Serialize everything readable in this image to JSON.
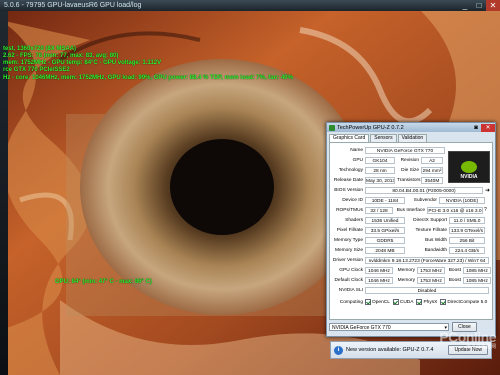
{
  "window": {
    "title": "5.0.6 - 79795  GPU-lavaeusR6  GPU load/log",
    "buttons": {
      "minimize": "_",
      "maximize": "□",
      "close": "✕"
    }
  },
  "osd": {
    "lines": [
      "test, 1360x720 (8X MSAA)",
      "2.62 - FPS: 78 (min: 77, max: 83, avg: 80)",
      "mem: 1752MHz - GPU temp: 84°C - GPU voltage: 1.112V",
      "rce GTX 770 PCIe/SSE2",
      "Hz - core: 1046MHz, mem: 1752MHz, GPU load: 99%, GPU power: 88.4 % TDP, mem load: 7%, fan: 40%"
    ],
    "temp_line1": "GPU: 84° (min: 47° C - max: 86° C)",
    "temp_line2": ""
  },
  "gpuz": {
    "title": "TechPowerUp GPU-Z 0.7.2",
    "tabs": [
      "Graphics Card",
      "Sensors",
      "Validation"
    ],
    "logo_text": "NVIDIA",
    "fields": {
      "name_label": "Name",
      "name": "NVIDIA GeForce GTX 770",
      "gpu_label": "GPU",
      "gpu": "GK104",
      "revision_label": "Revision",
      "revision": "A2",
      "tech_label": "Technology",
      "tech": "28 nm",
      "die_label": "Die Size",
      "die": "294 mm²",
      "release_label": "Release Date",
      "release": "May 30, 2013",
      "trans_label": "Transistors",
      "trans": "3540M",
      "bios_label": "BIOS Version",
      "bios": "80.04.B4.00.01 (P2005-0000)",
      "devid_label": "Device ID",
      "devid": "10DE - 1184",
      "subv_label": "Subvendor",
      "subv": "NVIDIA (10DE)",
      "rops_label": "ROPs/TMUs",
      "rops": "32 / 128",
      "bus_label": "Bus Interface",
      "bus": "PCI-E 3.0 x16 @ x16 3.0",
      "shaders_label": "Shaders",
      "shaders": "1536 Unified",
      "dx_label": "DirectX Support",
      "dx": "11.0 / SM5.0",
      "pixel_label": "Pixel Fillrate",
      "pixel": "33.5 GPixel/s",
      "tex_label": "Texture Fillrate",
      "tex": "133.9 GTexel/s",
      "memtype_label": "Memory Type",
      "memtype": "GDDR5",
      "buswidth_label": "Bus Width",
      "buswidth": "256 Bit",
      "memsize_label": "Memory Size",
      "memsize": "2048 MB",
      "bandwidth_label": "Bandwidth",
      "bandwidth": "224.4 GB/s",
      "driver_label": "Driver Version",
      "driver": "nvlddmkm 9.18.13.2723 (ForceWare 327.23) / Win7 64",
      "gpuclock_label": "GPU Clock",
      "gpuclock": "1046 MHz",
      "memory_label": "Memory",
      "memclock": "1753 MHz",
      "boost_label": "Boost",
      "boost": "1085 MHz",
      "defclock_label": "Default Clock",
      "defclock": "1046 MHz",
      "defmem": "1753 MHz",
      "defboost": "1085 MHz",
      "sli_label": "NVIDIA SLI",
      "sli": "Disabled",
      "computing_label": "Computing",
      "computing": [
        {
          "label": "OpenCL",
          "checked": true
        },
        {
          "label": "CUDA",
          "checked": true
        },
        {
          "label": "PhysX",
          "checked": true
        },
        {
          "label": "DirectCompute 5.0",
          "checked": true
        }
      ]
    },
    "selected_gpu": "NVIDIA GeForce GTX 770",
    "close_label": "Close"
  },
  "update": {
    "message": "New version available: GPU-Z 0.7.4",
    "button": "Update Now"
  },
  "watermark": {
    "text": "PConline",
    "sub": "太平洋电脑网"
  }
}
